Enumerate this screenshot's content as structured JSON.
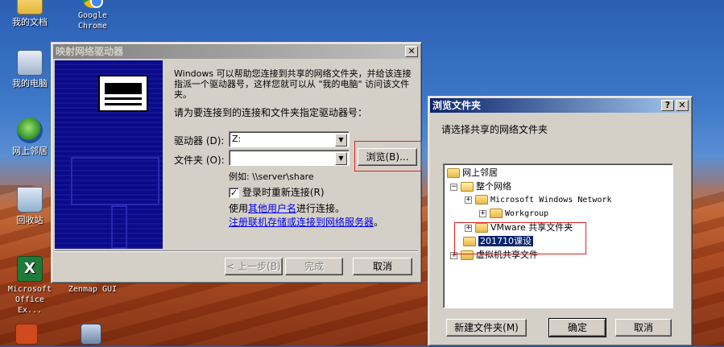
{
  "desktop": {
    "icons": [
      {
        "label": "我的文档",
        "icon": "folder-icon"
      },
      {
        "label": "Google Chrome",
        "icon": "chrome-icon"
      },
      {
        "label": "我的电脑",
        "icon": "computer-icon"
      },
      {
        "label": "网上邻居",
        "icon": "network-icon"
      },
      {
        "label": "回收站",
        "icon": "recycle-bin-icon"
      },
      {
        "label": "Microsoft Office Ex...",
        "icon": "excel-icon"
      },
      {
        "label": "Nmap - Zenmap GUI",
        "icon": "nmap-icon"
      }
    ]
  },
  "map_drive": {
    "title": "映射网络驱动器",
    "intro": "Windows 可以帮助您连接到共享的网络文件夹，并给该连接指派一个驱动器号，这样您就可以从 \"我的电脑\" 访问该文件夹。",
    "instruction": "请为要连接到的连接和文件夹指定驱动器号：",
    "drive_label": "驱动器 (D):",
    "drive_value": "Z:",
    "folder_label": "文件夹 (O):",
    "folder_value": "",
    "browse_label": "浏览(B)...",
    "example": "例如: \\\\server\\share",
    "reconnect_label": "登录时重新连接(R)",
    "reconnect_checked": true,
    "other_user_prefix": "使用",
    "other_user_link": "其他用户名",
    "other_user_suffix": "进行连接。",
    "register_link": "注册联机存储或连接到网络服务器",
    "register_suffix": "。",
    "back_label": "< 上一步(B)",
    "finish_label": "完成",
    "cancel_label": "取消",
    "close_glyph": "✕"
  },
  "browse": {
    "title": "浏览文件夹",
    "help_glyph": "?",
    "close_glyph": "✕",
    "prompt": "请选择共享的网络文件夹",
    "tree": [
      {
        "label": "网上邻居",
        "expander": ""
      },
      {
        "label": "整个网络",
        "expander": "−"
      },
      {
        "label": "Microsoft Windows Network",
        "expander": "+"
      },
      {
        "label": "Workgroup",
        "expander": "+"
      },
      {
        "label": "VMware 共享文件夹",
        "expander": "+"
      },
      {
        "label": "201710课设",
        "expander": "",
        "selected": true
      },
      {
        "label": "虚拟机共享文件",
        "expander": "+"
      }
    ],
    "new_folder_label": "新建文件夹(M)",
    "ok_label": "确定",
    "cancel_label": "取消"
  }
}
